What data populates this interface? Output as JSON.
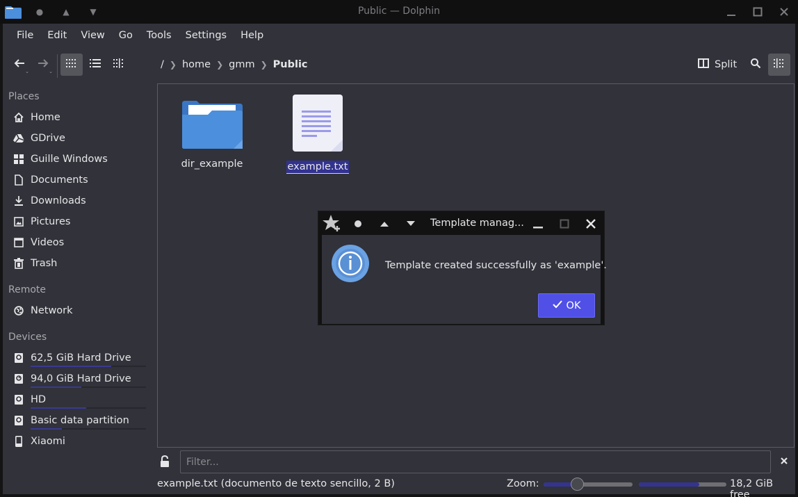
{
  "titlebar": {
    "title": "Public — Dolphin",
    "icons": [
      "folder-app-icon",
      "pin-dot-icon",
      "keep-above-icon",
      "keep-below-icon",
      "minimize-icon",
      "maximize-icon",
      "close-icon"
    ]
  },
  "menubar": {
    "items": [
      "File",
      "Edit",
      "View",
      "Go",
      "Tools",
      "Settings",
      "Help"
    ]
  },
  "toolbar": {
    "back": "back-icon",
    "forward": "forward-icon",
    "view_modes": [
      "icons-view",
      "details-view",
      "compact-view"
    ],
    "active_view": "icons-view",
    "breadcrumb": [
      "/",
      "home",
      "gmm",
      "Public"
    ],
    "split_label": "Split",
    "search": "search-icon",
    "info_panel": "panel-icon"
  },
  "sidebar": {
    "places_title": "Places",
    "places": [
      {
        "label": "Home",
        "icon": "home-icon"
      },
      {
        "label": "GDrive",
        "icon": "gdrive-icon"
      },
      {
        "label": "Guille Windows",
        "icon": "windows-icon"
      },
      {
        "label": "Documents",
        "icon": "document-icon"
      },
      {
        "label": "Downloads",
        "icon": "download-icon"
      },
      {
        "label": "Pictures",
        "icon": "picture-icon"
      },
      {
        "label": "Videos",
        "icon": "video-icon"
      },
      {
        "label": "Trash",
        "icon": "trash-icon"
      }
    ],
    "remote_title": "Remote",
    "remote": [
      {
        "label": "Network",
        "icon": "network-icon"
      }
    ],
    "devices_title": "Devices",
    "devices": [
      {
        "label": "62,5 GiB Hard Drive",
        "icon": "harddrive-icon",
        "usage": 0.7
      },
      {
        "label": "94,0 GiB Hard Drive",
        "icon": "harddrive-icon",
        "usage": 0.44
      },
      {
        "label": "HD",
        "icon": "harddrive-icon",
        "usage": 0.48
      },
      {
        "label": "Basic data partition",
        "icon": "harddrive-icon",
        "usage": 0.27
      },
      {
        "label": "Xiaomi",
        "icon": "phone-icon"
      }
    ]
  },
  "files": [
    {
      "name": "dir_example",
      "type": "folder",
      "selected": false
    },
    {
      "name": "example.txt",
      "type": "text",
      "selected": true
    }
  ],
  "filter": {
    "placeholder": "Filter...",
    "value": ""
  },
  "status": {
    "text": "example.txt (documento de texto sencillo, 2 B)",
    "zoom_label": "Zoom:",
    "zoom_level": 0.38,
    "disk_usage": 0.69,
    "free_space": "18,2 GiB free"
  },
  "dialog": {
    "title": "Template manag...",
    "message": "Template created successfully as 'example'.",
    "ok_label": "OK",
    "icon": "info-icon"
  },
  "colors": {
    "accent": "#5050e6",
    "selection": "#323290",
    "folder": "#4c8fdc"
  }
}
